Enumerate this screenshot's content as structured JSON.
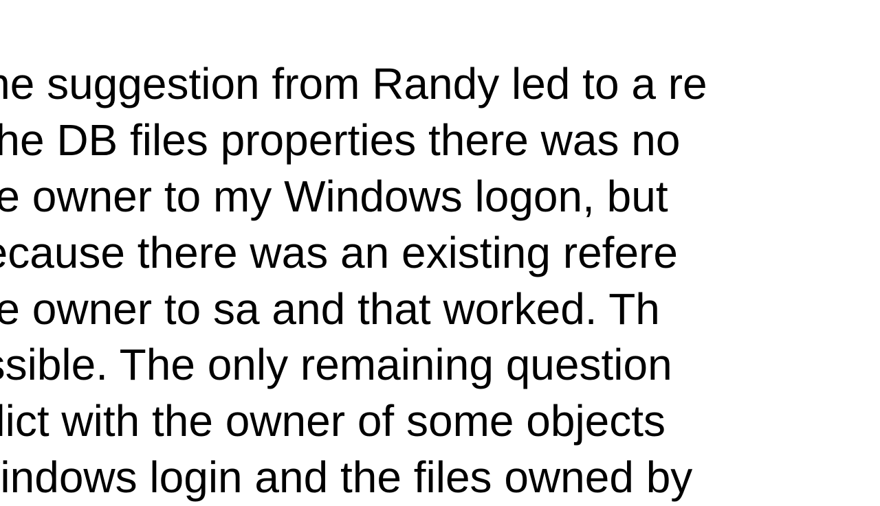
{
  "document": {
    "lines": [
      "The suggestion from Randy led to a re",
      "t the DB files properties there was no",
      "  the owner to my Windows logon, but",
      "because there was an existing refere",
      " the owner to sa and that worked.  Th",
      "essible.  The only remaining question",
      "nflict with the owner of some objects ",
      "Windows login and the files owned by"
    ]
  }
}
